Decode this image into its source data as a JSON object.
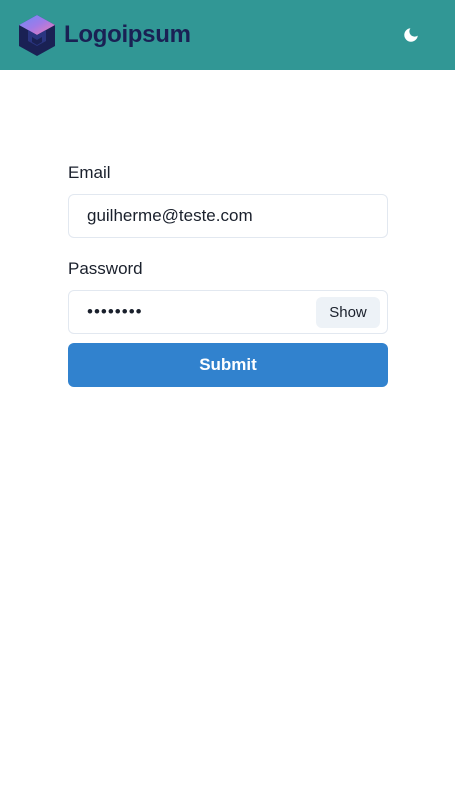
{
  "header": {
    "logo_text": "Logoipsum",
    "logo_icon": "hexagon-cube-logo",
    "theme_toggle_icon": "moon-icon",
    "background": "#319795"
  },
  "form": {
    "email_label": "Email",
    "email_value": "guilherme@teste.com",
    "password_label": "Password",
    "password_value": "••••••••",
    "show_label": "Show",
    "submit_label": "Submit",
    "submit_color": "#3182ce"
  }
}
